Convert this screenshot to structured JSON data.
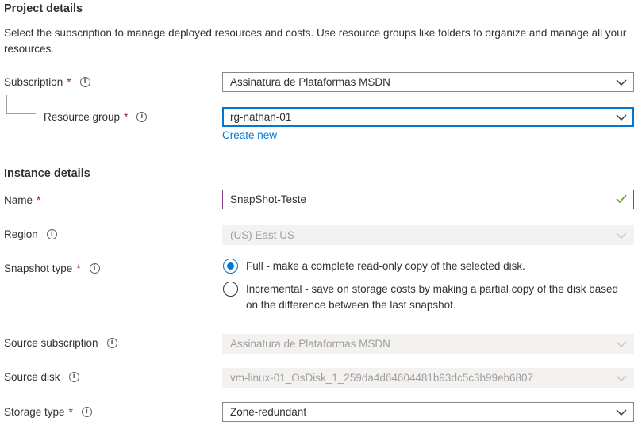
{
  "project": {
    "title": "Project details",
    "description": "Select the subscription to manage deployed resources and costs. Use resource groups like folders to organize and manage all your resources."
  },
  "subscription": {
    "label": "Subscription",
    "required": "*",
    "value": "Assinatura de Plataformas MSDN"
  },
  "resource_group": {
    "label": "Resource group",
    "required": "*",
    "value": "rg-nathan-01",
    "create_new": "Create new"
  },
  "instance": {
    "title": "Instance details"
  },
  "name": {
    "label": "Name",
    "required": "*",
    "value": "SnapShot-Teste",
    "valid_icon": "checkmark-icon"
  },
  "region": {
    "label": "Region",
    "value": "(US) East US"
  },
  "snapshot_type": {
    "label": "Snapshot type",
    "required": "*",
    "options": [
      {
        "label": "Full - make a complete read-only copy of the selected disk.",
        "selected": true
      },
      {
        "label": "Incremental - save on storage costs by making a partial copy of the disk based on the difference between the last snapshot.",
        "selected": false
      }
    ]
  },
  "source_subscription": {
    "label": "Source subscription",
    "value": "Assinatura de Plataformas MSDN"
  },
  "source_disk": {
    "label": "Source disk",
    "value": "vm-linux-01_OsDisk_1_259da4d64604481b93dc5c3b99eb6807"
  },
  "storage_type": {
    "label": "Storage type",
    "required": "*",
    "value": "Zone-redundant"
  },
  "colors": {
    "accent": "#0078d4",
    "required": "#a4262c",
    "valid": "#57a300",
    "disabled_bg": "#f3f2f1"
  }
}
